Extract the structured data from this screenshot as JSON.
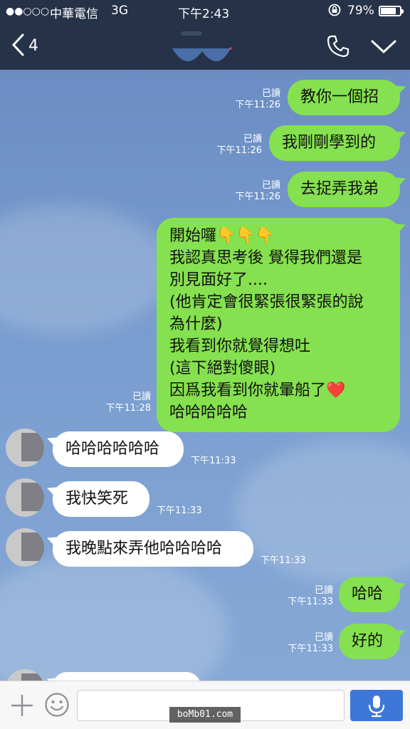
{
  "status_bar": {
    "signal": "●●○○○",
    "carrier": "中華電信",
    "network": "3G",
    "time": "下午2:43",
    "battery_percent": "79%",
    "battery_level": 0.79
  },
  "header": {
    "back_count": "4",
    "back_icon": "chevron-left-icon",
    "call_icon": "phone-icon",
    "menu_icon": "chevron-down-icon"
  },
  "messages": [
    {
      "dir": "out",
      "text": "教你一個招",
      "read": "已讀",
      "time": "下午11:26"
    },
    {
      "dir": "out",
      "text": "我剛剛學到的",
      "read": "已讀",
      "time": "下午11:26"
    },
    {
      "dir": "out",
      "text": "去捉弄我弟",
      "read": "已讀",
      "time": "下午11:26"
    },
    {
      "dir": "out",
      "lines": [
        "開始囉👇👇👇",
        "我認真思考後 覺得我們還是",
        "別見面好了....",
        "(他肯定會很緊張很緊張的說",
        "為什麼)",
        "我看到你就覺得想吐",
        "(這下絕對傻眼)",
        "因爲我看到你就暈船了❤️",
        "哈哈哈哈哈"
      ],
      "read": "已讀",
      "time": "下午11:28"
    },
    {
      "dir": "in",
      "text": "哈哈哈哈哈哈",
      "time": "下午11:33"
    },
    {
      "dir": "in",
      "text": "我快笑死",
      "time": "下午11:33"
    },
    {
      "dir": "in",
      "text": "我晚點來弄他哈哈哈哈",
      "time": "下午11:33"
    },
    {
      "dir": "out",
      "text": "哈哈",
      "read": "已讀",
      "time": "下午11:33"
    },
    {
      "dir": "out",
      "text": "好的",
      "read": "已讀",
      "time": "下午11:33"
    }
  ],
  "composer": {
    "plus_icon": "plus-icon",
    "emoji_icon": "emoji-icon",
    "input_value": "",
    "mic_icon": "mic-icon"
  },
  "watermark": "boMb01.com",
  "colors": {
    "bar": "#263248",
    "outgoing": "#85e14f",
    "incoming": "#ffffff",
    "chat_bg": "#7a9dd0",
    "mic": "#3d78d8"
  }
}
